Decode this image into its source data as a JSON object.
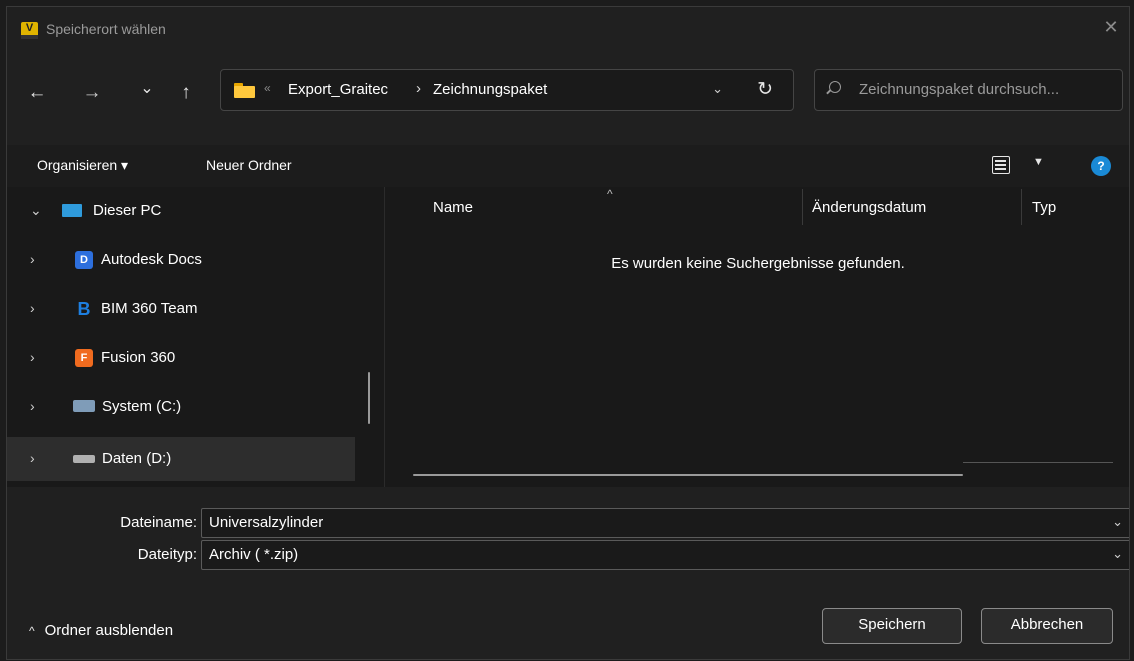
{
  "window": {
    "title": "Speicherort wählen",
    "app_icon_letter": "V"
  },
  "nav": {
    "back_icon": "←",
    "forward_icon": "→",
    "recent_icon": "⌄",
    "up_icon": "↑",
    "path_chevron": "«",
    "breadcrumb": [
      "Export_Graitec",
      "Zeichnungspaket"
    ],
    "breadcrumb_sep": "›",
    "address_dropdown_icon": "⌄",
    "refresh_icon": "↻",
    "search_placeholder": "Zeichnungspaket durchsuch..."
  },
  "toolbar": {
    "organize_label": "Organisieren ▾",
    "new_folder_label": "Neuer Ordner",
    "view_drop": "▼",
    "help": "?"
  },
  "sidebar": {
    "items": [
      {
        "label": "Dieser PC",
        "chevron": "⌄",
        "icon": "pc-icon",
        "icon_text": "",
        "color": "#2f9bdc"
      },
      {
        "label": "Autodesk Docs",
        "chevron": "›",
        "icon": "autodesk-docs-icon",
        "icon_text": "D",
        "color": "#2d6fdd"
      },
      {
        "label": "BIM 360 Team",
        "chevron": "›",
        "icon": "bim360-icon",
        "icon_text": "B",
        "color": "#1e7fe0"
      },
      {
        "label": "Fusion 360",
        "chevron": "›",
        "icon": "fusion360-icon",
        "icon_text": "F",
        "color": "#f06b1f"
      },
      {
        "label": "System (C:)",
        "chevron": "›",
        "icon": "system-drive-icon",
        "icon_text": "",
        "color": "#7f9cb8"
      },
      {
        "label": "Daten (D:)",
        "chevron": "›",
        "icon": "data-drive-icon",
        "icon_text": "",
        "color": "#b0b0b0"
      }
    ],
    "selected_index": 5
  },
  "list": {
    "columns": [
      "Name",
      "Änderungsdatum",
      "Typ"
    ],
    "sort_indicator": "^",
    "empty_message": "Es wurden keine Suchergebnisse gefunden."
  },
  "form": {
    "filename_label": "Dateiname:",
    "filename_value": "Universalzylinder",
    "filetype_label": "Dateityp:",
    "filetype_value": "Archiv ( *.zip)",
    "dropdown_icon": "⌄"
  },
  "footer": {
    "hide_folders_label": "Ordner ausblenden",
    "hide_caret": "^",
    "save_label": "Speichern",
    "cancel_label": "Abbrechen"
  },
  "colors": {
    "background": "#191919",
    "accent": "#1a8ad6",
    "folder": "#ffc83d"
  }
}
